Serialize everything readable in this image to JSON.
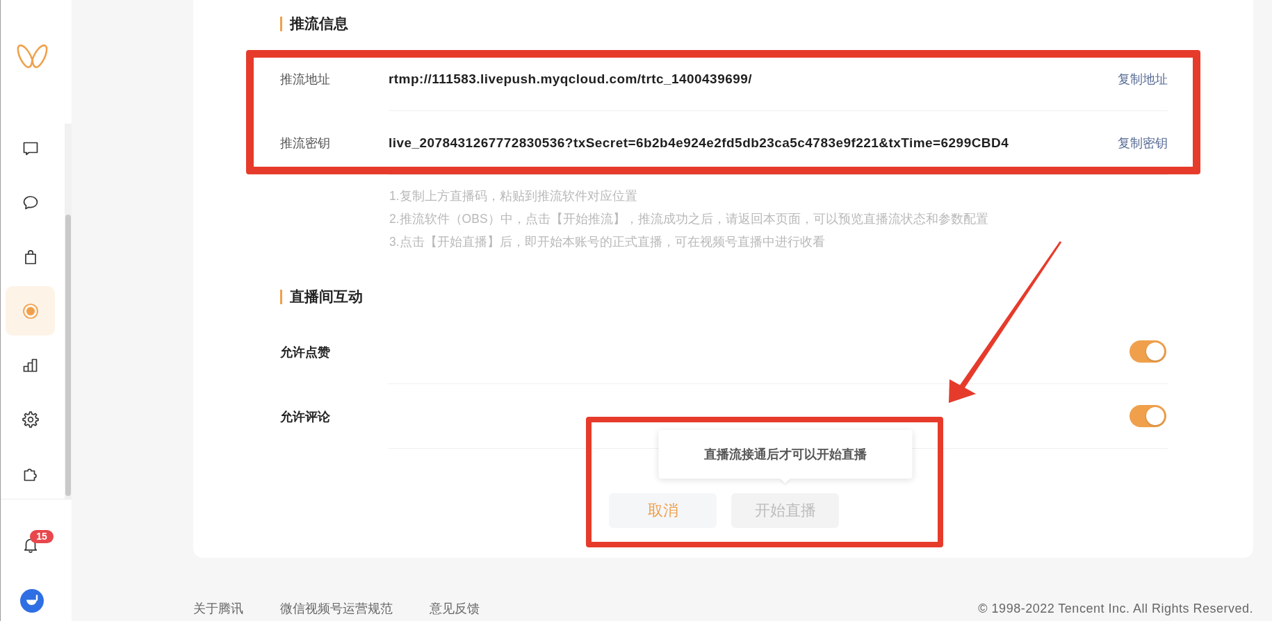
{
  "sidebar": {
    "items": [
      {
        "kind": "messages",
        "selected": false
      },
      {
        "kind": "comments",
        "selected": false
      },
      {
        "kind": "shop",
        "selected": false
      },
      {
        "kind": "live",
        "selected": true
      },
      {
        "kind": "stats",
        "selected": false
      },
      {
        "kind": "settings",
        "selected": false
      },
      {
        "kind": "plugins",
        "selected": false
      }
    ],
    "notification_badge": "15"
  },
  "stream_info": {
    "title": "推流信息",
    "highlighted": true,
    "rows": [
      {
        "label": "推流地址",
        "value": "rtmp://111583.livepush.myqcloud.com/trtc_1400439699/",
        "action": "复制地址"
      },
      {
        "label": "推流密钥",
        "value": "live_2078431267772830536?txSecret=6b2b4e924e2fd5db23ca5c4783e9f221&txTime=6299CBD4",
        "action": "复制密钥"
      }
    ],
    "instructions": [
      "1.复制上方直播码，粘贴到推流软件对应位置",
      "2.推流软件（OBS）中，点击【开始推流】，推流成功之后，请返回本页面，可以预览直播流状态和参数配置",
      "3.点击【开始直播】后，即开始本账号的正式直播，可在视频号直播中进行收看"
    ]
  },
  "interaction": {
    "title": "直播间互动",
    "settings": [
      {
        "label": "允许点赞",
        "on": true
      },
      {
        "label": "允许评论",
        "on": true
      }
    ]
  },
  "actions": {
    "highlighted": true,
    "arrow": true,
    "buttons": [
      {
        "label": "取消",
        "kind": "cancel",
        "disabled": false
      },
      {
        "label": "开始直播",
        "kind": "start",
        "disabled": true,
        "tooltip": "直播流接通后才可以开始直播"
      }
    ]
  },
  "footer": {
    "links": [
      "关于腾讯",
      "微信视频号运营规范",
      "意见反馈"
    ],
    "copyright": "© 1998-2022 Tencent Inc. All Rights Reserved."
  }
}
